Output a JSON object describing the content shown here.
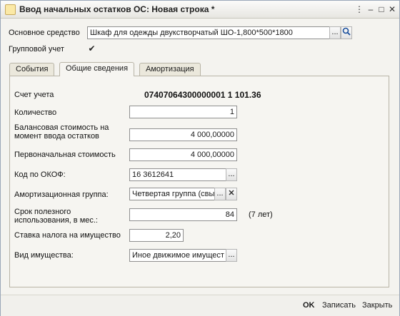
{
  "window": {
    "title": "Ввод начальных остатков ОС: Новая строка *"
  },
  "header": {
    "asset_label": "Основное средство",
    "asset_value": "Шкаф для одежды  двукстворчатый ШО-1,800*500*1800",
    "asset_dots": "...",
    "group_label": "Групповой учет",
    "group_checked": "✔"
  },
  "tabs": [
    {
      "label": "События"
    },
    {
      "label": "Общие сведения"
    },
    {
      "label": "Амортизация"
    }
  ],
  "form": {
    "account_label": "Счет учета",
    "account_value": "07407064300000001  1  101.36",
    "qty_label": "Количество",
    "qty_value": "1",
    "balance_label_1": "Балансовая стоимость на",
    "balance_label_2": "момент ввода остатков",
    "balance_value": "4 000,00000",
    "initial_label": "Первоначальная стоимость",
    "initial_value": "4 000,00000",
    "okof_label": "Код по ОКОФ:",
    "okof_value": "16 3612641",
    "dots": "...",
    "amort_label": "Амортизационная группа:",
    "amort_value": "Четвертая группа (свы",
    "clear_icon": "✕",
    "life_label_1": "Срок полезного",
    "life_label_2": "использования, в мес.:",
    "life_value": "84",
    "life_years": "(7 лет)",
    "tax_label": "Ставка налога на имущество",
    "tax_value": "2,20",
    "property_label": "Вид имущества:",
    "property_value": "Иное движимое имущест"
  },
  "footer": {
    "ok": "OK",
    "save": "Записать",
    "close": "Закрыть"
  }
}
